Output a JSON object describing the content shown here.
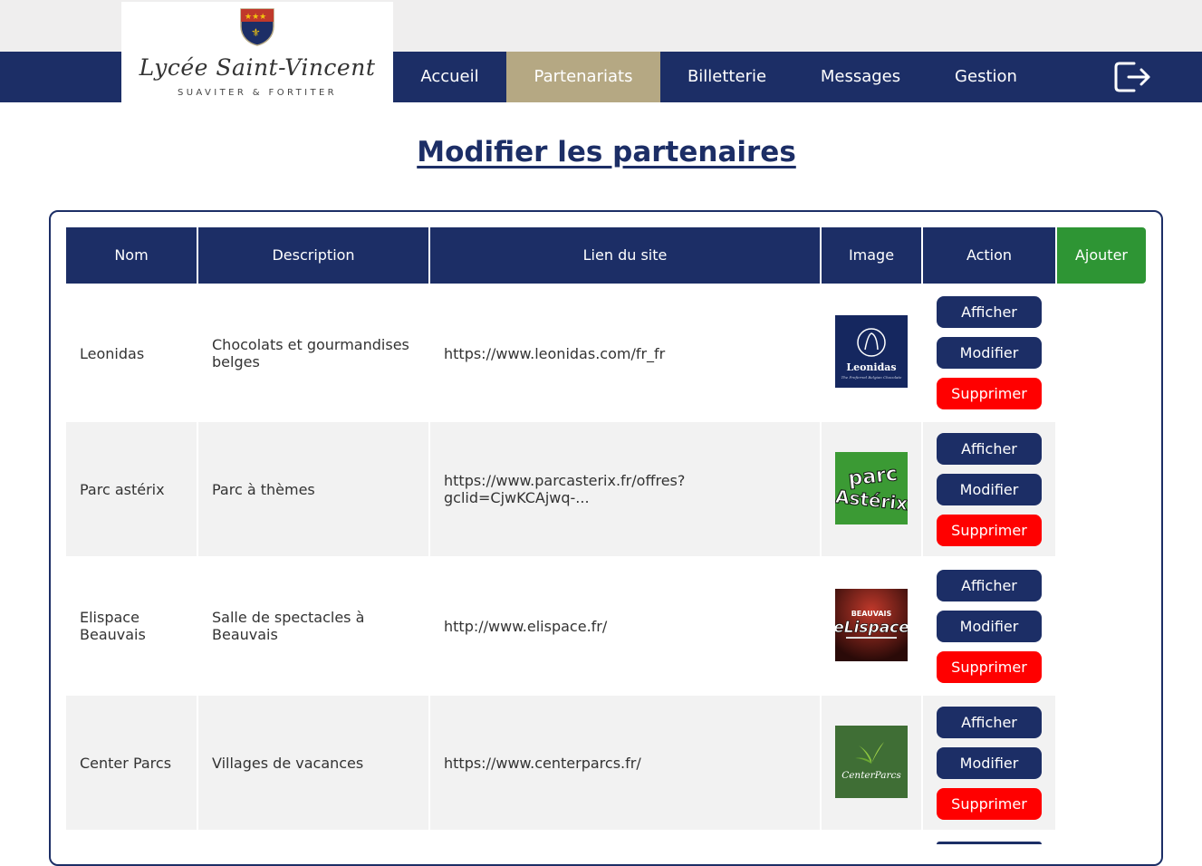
{
  "brand": {
    "title": "Lycée Saint-Vincent",
    "motto": "SUAVITER & FORTITER"
  },
  "nav": {
    "items": [
      "Accueil",
      "Partenariats",
      "Billetterie",
      "Messages",
      "Gestion"
    ],
    "active": "Partenariats"
  },
  "page": {
    "title": "Modifier les partenaires"
  },
  "table": {
    "headers": [
      "Nom",
      "Description",
      "Lien du site",
      "Image",
      "Action"
    ],
    "add_label": "Ajouter",
    "actions": {
      "view": "Afficher",
      "edit": "Modifier",
      "delete": "Supprimer"
    },
    "rows": [
      {
        "name": "Leonidas",
        "description": "Chocolats et gourmandises belges",
        "link": "https://www.leonidas.com/fr_fr",
        "image": "leonidas-logo"
      },
      {
        "name": "Parc astérix",
        "description": "Parc à thèmes",
        "link": "https://www.parcasterix.fr/offres?gclid=CjwKCAjwq-...",
        "image": "parc-asterix-logo"
      },
      {
        "name": "Elispace Beauvais",
        "description": "Salle de spectacles à Beauvais",
        "link": "http://www.elispace.fr/",
        "image": "elispace-logo"
      },
      {
        "name": "Center Parcs",
        "description": "Villages de vacances",
        "link": "https://www.centerparcs.fr/",
        "image": "center-parcs-logo"
      }
    ]
  },
  "logo_text": {
    "leonidas": "Leonidas",
    "leonidas_tagline": "The Preferred Belgian Chocolate",
    "asterix_1": "parc",
    "asterix_2": "Astérix",
    "elispace_top": "BEAUVAIS",
    "elispace": "eLispace",
    "centerparcs": "CenterParcs"
  },
  "colors": {
    "navy": "#1c2e66",
    "active_tab": "#b5a883",
    "add_green": "#2e9534",
    "delete_red": "#ff0000",
    "row_grey": "#f2f2f2"
  }
}
